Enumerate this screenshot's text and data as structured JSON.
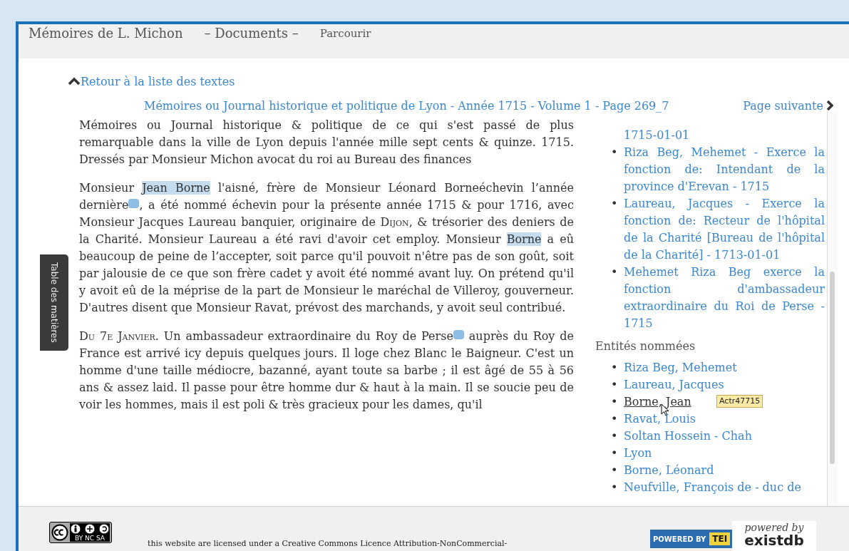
{
  "header": {
    "site_title": "Mémoires de L. Michon",
    "menu": [
      {
        "label": "– Documents –"
      },
      {
        "label": "Parcourir"
      }
    ]
  },
  "back_link": "Retour à la liste des textes",
  "breadcrumb": "Mémoires ou Journal historique et politique de Lyon - Année 1715 - Volume 1 - Page 269_7",
  "next_link": "Page suivante",
  "toc_tab": "Table des matières",
  "paragraphs": [
    [
      {
        "kind": "text",
        "text": "Mémoires ou Journal historique & politique de ce qui s'est passé de plus remarquable dans la ville de Lyon depuis l'année mille sept cents & quinze. 1715. Dressés par Monsieur Michon avocat du roi au Bureau des finances"
      }
    ],
    [
      {
        "kind": "text",
        "text": "Monsieur "
      },
      {
        "kind": "name",
        "text": "Jean Borne"
      },
      {
        "kind": "text",
        "text": " l'aisné, frère de Monsieur Léonard Borneéchevin l’année dernière"
      },
      {
        "kind": "note"
      },
      {
        "kind": "text",
        "text": ", a été nommé échevin pour la présente année 1715 & pour 1716, avec Monsieur Jacques Laureau banquier, originaire de "
      },
      {
        "kind": "smallcaps",
        "text": "Dijon"
      },
      {
        "kind": "text",
        "text": ", & trésorier des deniers de la Charité. Monsieur Laureau a été ravi d'avoir cet employ. Monsieur "
      },
      {
        "kind": "name",
        "text": "Borne"
      },
      {
        "kind": "text",
        "text": " a eû beaucoup de peine de l’accepter, soit parce qu'il pouvoit n'être pas de son goût, soit par jalousie de ce que son frère cadet y avoit été nommé avant luy. On prétend qu'il y avoit eû de la méprise de la part de Monsieur le maréchal de Villeroy, gouverneur. D'autres disent que Monsieur Ravat, prévost des marchands, y avoit seul contribué."
      }
    ],
    [
      {
        "kind": "smallcaps",
        "text": "Du 7e Janvier"
      },
      {
        "kind": "text",
        "text": ". Un ambassadeur extraordinaire du Roy de Perse"
      },
      {
        "kind": "note"
      },
      {
        "kind": "text",
        "text": " auprès du Roy de France est arrivé icy depuis quelques jours. Il loge chez Blanc le Baigneur. C'est un homme d'une taille médiocre, bazanné, ayant toute sa barbe ; il est âgé de 55 à 56 ans & assez laid. Il passe pour être homme dur & haut à la main. Il se soucie peu de voir les hommes, mais il est poli & très gracieux pour les dames, qu'il"
      }
    ]
  ],
  "sidebar": {
    "functions": [
      {
        "text": "1715-01-01"
      },
      {
        "marker": "•",
        "text": "Riza Beg, Mehemet - Exerce la fonction de: Intendant de la province d'Erevan - 1715"
      },
      {
        "marker": "•",
        "text": "Laureau, Jacques - Exerce la fonction de: Recteur de l'hôpital de la Charité [Bureau de l'hôpital de la Charité] - 1713-01-01"
      },
      {
        "marker": "•",
        "text": "Mehemet Riza Beg exerce la fonction d'ambassadeur extraordinaire du Roi de Perse - 1715"
      }
    ],
    "entities_heading": "Entités nommées",
    "entities": [
      {
        "marker": "•",
        "text": "Riza Beg, Mehemet",
        "hovered": false
      },
      {
        "marker": "•",
        "text": "Laureau, Jacques",
        "hovered": false
      },
      {
        "marker": "•",
        "text": "Borne, Jean",
        "hovered": true
      },
      {
        "marker": "•",
        "text": "Ravat, Louis",
        "hovered": false
      },
      {
        "marker": "•",
        "text": "Soltan Hossein - Chah",
        "hovered": false
      },
      {
        "marker": "•",
        "text": "Lyon",
        "hovered": false
      },
      {
        "marker": "•",
        "text": "Borne, Léonard",
        "hovered": false
      },
      {
        "marker": "•",
        "text": "Neufville, François de - duc de",
        "hovered": false
      }
    ],
    "tooltip": "Actr47715"
  },
  "footer": {
    "cc_badge": "BY NC SA",
    "tei_badge": [
      "POWERED BY",
      "TEI"
    ],
    "exist_badge": [
      "powered by",
      "existdb"
    ],
    "licence_text": "this website are licensed under a Creative Commons Licence Attribution-NonCommercial-"
  }
}
